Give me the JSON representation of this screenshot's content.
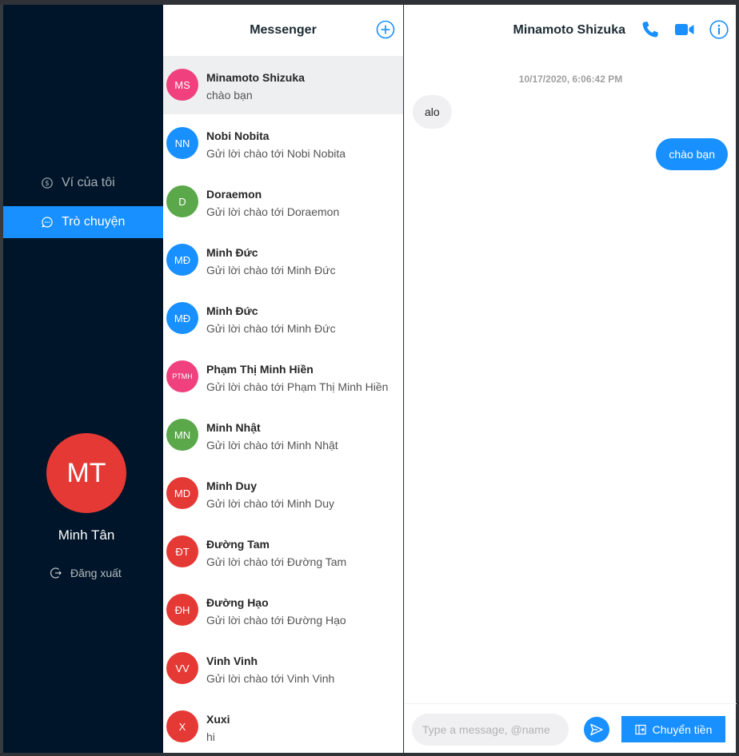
{
  "colors": {
    "sidebar_bg": "#001529",
    "accent": "#1890ff",
    "avatar_pink": "#f0407e",
    "avatar_blue": "#1890ff",
    "avatar_green": "#5aa84a",
    "avatar_red": "#e53935"
  },
  "sidebar": {
    "items": [
      {
        "label": "Ví của tôi",
        "icon": "dollar-circle-icon",
        "active": false
      },
      {
        "label": "Trò chuyện",
        "icon": "chat-bubble-icon",
        "active": true
      }
    ],
    "user": {
      "initials": "MT",
      "name": "Minh Tân"
    },
    "logout_label": "Đăng xuất",
    "logout_icon": "logout-icon"
  },
  "conversations": {
    "title": "Messenger",
    "add_icon": "plus-circle-icon",
    "items": [
      {
        "initials": "MS",
        "name": "Minamoto Shizuka",
        "preview": "chào bạn",
        "color": "#f0407e",
        "active": true
      },
      {
        "initials": "NN",
        "name": "Nobi Nobita",
        "preview": "Gửi lời chào tới Nobi Nobita",
        "color": "#1890ff"
      },
      {
        "initials": "D",
        "name": "Doraemon",
        "preview": "Gửi lời chào tới Doraemon",
        "color": "#5aa84a"
      },
      {
        "initials": "MĐ",
        "name": "Minh Đức",
        "preview": "Gửi lời chào tới Minh Đức",
        "color": "#1890ff"
      },
      {
        "initials": "MĐ",
        "name": "Minh Đức",
        "preview": "Gửi lời chào tới Minh Đức",
        "color": "#1890ff"
      },
      {
        "initials": "PTMH",
        "name": "Phạm Thị Minh Hiền",
        "preview": "Gửi lời chào tới Phạm Thị Minh Hiền",
        "color": "#f0407e",
        "small": true
      },
      {
        "initials": "MN",
        "name": "Minh Nhật",
        "preview": "Gửi lời chào tới Minh Nhật",
        "color": "#5aa84a"
      },
      {
        "initials": "MD",
        "name": "Minh Duy",
        "preview": "Gửi lời chào tới Minh Duy",
        "color": "#e53935"
      },
      {
        "initials": "ĐT",
        "name": "Đường Tam",
        "preview": "Gửi lời chào tới Đường Tam",
        "color": "#e53935"
      },
      {
        "initials": "ĐH",
        "name": "Đường Hạo",
        "preview": "Gửi lời chào tới Đường Hạo",
        "color": "#e53935"
      },
      {
        "initials": "VV",
        "name": "Vinh Vinh",
        "preview": "Gửi lời chào tới Vinh Vinh",
        "color": "#e53935"
      },
      {
        "initials": "X",
        "name": "Xuxi",
        "preview": "hi",
        "color": "#e53935"
      }
    ]
  },
  "chat": {
    "contact_name": "Minamoto Shizuka",
    "header_icons": [
      "phone-icon",
      "video-camera-icon",
      "info-icon"
    ],
    "timestamp": "10/17/2020, 6:06:42 PM",
    "messages": [
      {
        "direction": "in",
        "text": "alo"
      },
      {
        "direction": "out",
        "text": "chào bạn"
      }
    ],
    "input_placeholder": "Type a message, @name",
    "input_value": "",
    "send_icon": "send-icon",
    "transfer_label": "Chuyển tiền",
    "transfer_icon": "transfer-icon"
  }
}
